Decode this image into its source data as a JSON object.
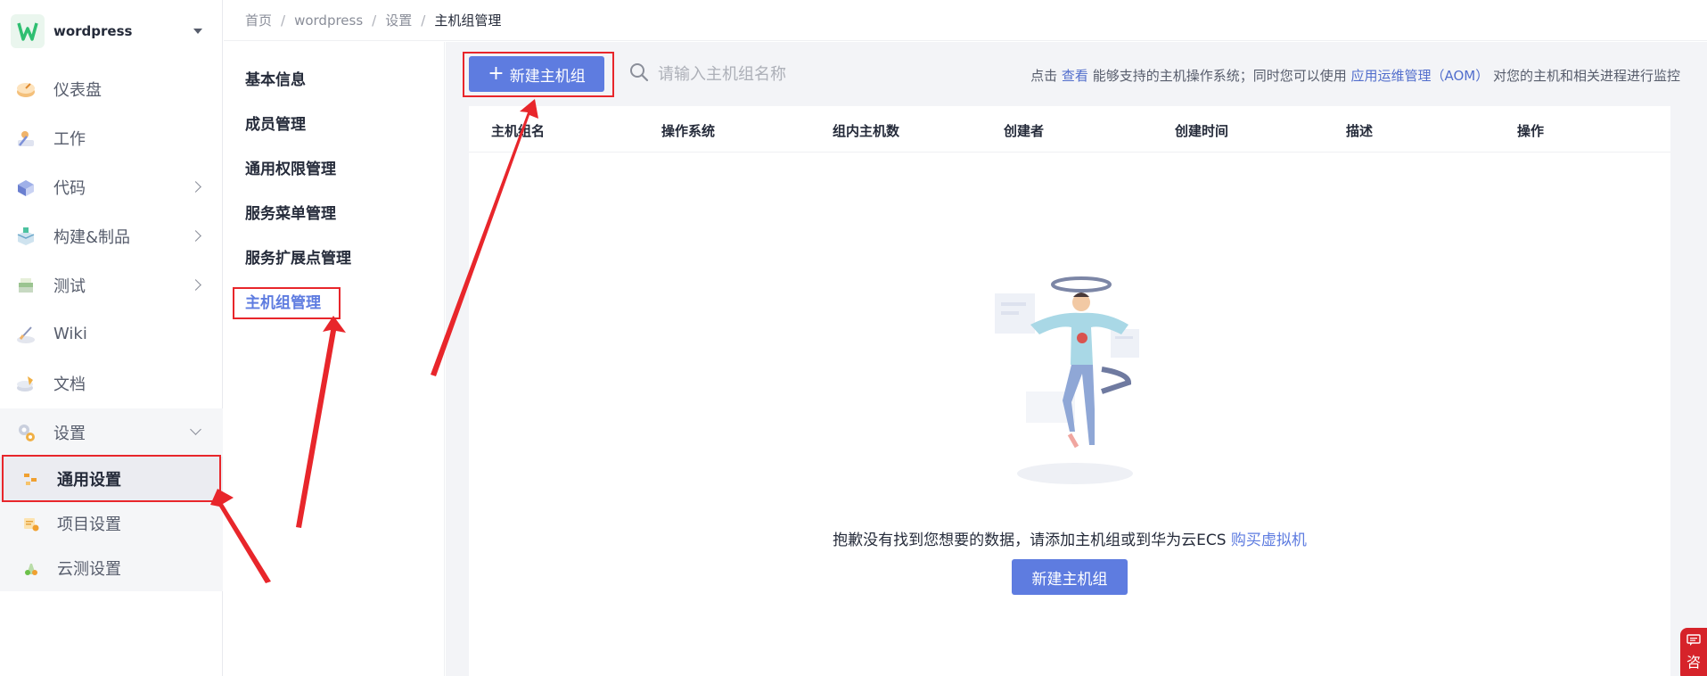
{
  "project": {
    "name": "wordpress"
  },
  "nav": {
    "items": [
      {
        "label": "仪表盘",
        "icon": "dashboard-icon"
      },
      {
        "label": "工作",
        "icon": "work-icon"
      },
      {
        "label": "代码",
        "icon": "code-icon"
      },
      {
        "label": "构建&制品",
        "icon": "build-icon"
      },
      {
        "label": "测试",
        "icon": "test-icon"
      },
      {
        "label": "Wiki",
        "icon": "wiki-icon"
      },
      {
        "label": "文档",
        "icon": "docs-icon"
      },
      {
        "label": "设置",
        "icon": "settings-icon"
      }
    ],
    "sub_items": [
      {
        "label": "通用设置",
        "icon": "general-settings-icon"
      },
      {
        "label": "项目设置",
        "icon": "project-settings-icon"
      },
      {
        "label": "云测设置",
        "icon": "cloudtest-settings-icon"
      }
    ]
  },
  "breadcrumb": [
    "首页",
    "wordpress",
    "设置",
    "主机组管理"
  ],
  "submenu": [
    "基本信息",
    "成员管理",
    "通用权限管理",
    "服务菜单管理",
    "服务扩展点管理",
    "主机组管理"
  ],
  "toolbar": {
    "new_button": "新建主机组",
    "search_placeholder": "请输入主机组名称",
    "hint": {
      "pre": "点击 ",
      "link1": "查看",
      "mid": " 能够支持的主机操作系统；同时您可以使用 ",
      "link2": "应用运维管理（AOM）",
      "post": " 对您的主机和相关进程进行监控"
    }
  },
  "table": {
    "columns": [
      "主机组名",
      "操作系统",
      "组内主机数",
      "创建者",
      "创建时间",
      "描述",
      "操作"
    ]
  },
  "empty": {
    "message": "抱歉没有找到您想要的数据，请添加主机组或到华为云ECS ",
    "link": "购买虚拟机",
    "button": "新建主机组"
  },
  "float_tab": {
    "label": "咨"
  },
  "colors": {
    "primary": "#5e7ce0",
    "annotation_red": "#e8262b"
  }
}
